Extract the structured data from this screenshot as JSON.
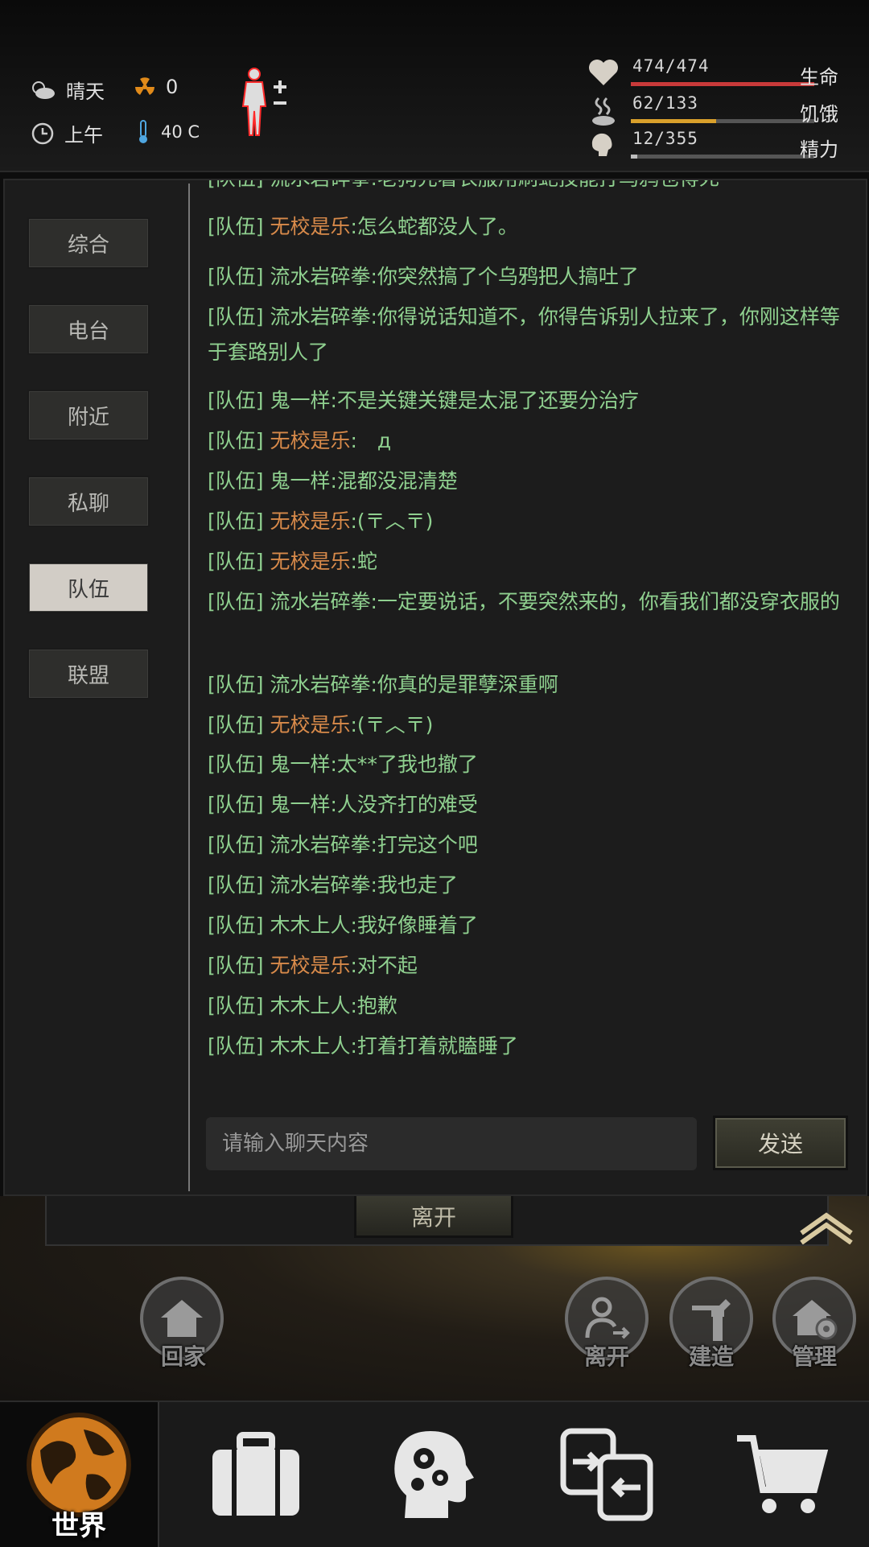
{
  "status": {
    "weather": "晴天",
    "radiation": "0",
    "time_of_day": "上午",
    "temperature": "40 C",
    "health": {
      "value": "474/474",
      "label": "生命",
      "fraction": 1.0,
      "color": "#c83a3a"
    },
    "hunger": {
      "value": "62/133",
      "label": "饥饿",
      "fraction": 0.466,
      "color": "#d9a02b"
    },
    "energy": {
      "value": "12/355",
      "label": "精力",
      "fraction": 0.034,
      "color": "#bdbdbd"
    }
  },
  "channels": [
    {
      "label": "综合",
      "active": false
    },
    {
      "label": "电台",
      "active": false
    },
    {
      "label": "附近",
      "active": false
    },
    {
      "label": "私聊",
      "active": false
    },
    {
      "label": "队伍",
      "active": true
    },
    {
      "label": "联盟",
      "active": false
    }
  ],
  "messages": [
    {
      "channel": "[队伍]",
      "sender": "流水岩碎拳",
      "text": ":老狗先看衣服用刷蛇技能打乌鸦也得死",
      "sender_color": "green"
    },
    {
      "channel": "[队伍]",
      "sender": "无校是乐",
      "text": ":怎么蛇都没人了。",
      "sender_color": "orange"
    },
    {
      "channel": "[队伍]",
      "sender": "流水岩碎拳",
      "text": ":你突然搞了个乌鸦把人搞吐了",
      "sender_color": "green"
    },
    {
      "channel": "[队伍]",
      "sender": "流水岩碎拳",
      "text": ":你得说话知道不，你得告诉别人拉来了，你刚这样等于套路别人了",
      "sender_color": "green"
    },
    {
      "channel": "[队伍]",
      "sender": "鬼一样",
      "text": ":不是关键关键是太混了还要分治疗",
      "sender_color": "green"
    },
    {
      "channel": "[队伍]",
      "sender": "无校是乐",
      "text": ":　д",
      "sender_color": "orange"
    },
    {
      "channel": "[队伍]",
      "sender": "鬼一样",
      "text": ":混都没混清楚",
      "sender_color": "green"
    },
    {
      "channel": "[队伍]",
      "sender": "无校是乐",
      "text": ":(〒︿〒)",
      "sender_color": "orange"
    },
    {
      "channel": "[队伍]",
      "sender": "无校是乐",
      "text": ":蛇",
      "sender_color": "orange"
    },
    {
      "channel": "[队伍]",
      "sender": "流水岩碎拳",
      "text": ":一定要说话，不要突然来的，你看我们都没穿衣服的",
      "sender_color": "green"
    },
    {
      "channel": "[队伍]",
      "sender": "流水岩碎拳",
      "text": ":你真的是罪孽深重啊",
      "sender_color": "green"
    },
    {
      "channel": "[队伍]",
      "sender": "无校是乐",
      "text": ":(〒︿〒)",
      "sender_color": "orange"
    },
    {
      "channel": "[队伍]",
      "sender": "鬼一样",
      "text": ":太**了我也撤了",
      "sender_color": "green"
    },
    {
      "channel": "[队伍]",
      "sender": "鬼一样",
      "text": ":人没齐打的难受",
      "sender_color": "green"
    },
    {
      "channel": "[队伍]",
      "sender": "流水岩碎拳",
      "text": ":打完这个吧",
      "sender_color": "green"
    },
    {
      "channel": "[队伍]",
      "sender": "流水岩碎拳",
      "text": ":我也走了",
      "sender_color": "green"
    },
    {
      "channel": "[队伍]",
      "sender": "木木上人",
      "text": ":我好像睡着了",
      "sender_color": "green"
    },
    {
      "channel": "[队伍]",
      "sender": "无校是乐",
      "text": ":对不起",
      "sender_color": "orange"
    },
    {
      "channel": "[队伍]",
      "sender": "木木上人",
      "text": ":抱歉",
      "sender_color": "green"
    },
    {
      "channel": "[队伍]",
      "sender": "木木上人",
      "text": ":打着打着就瞌睡了",
      "sender_color": "green"
    }
  ],
  "input": {
    "placeholder": "请输入聊天内容",
    "send_label": "发送"
  },
  "scene": {
    "leave_button": "离开",
    "actions": [
      {
        "label": "回家",
        "icon": "home-icon"
      },
      {
        "label": "离开",
        "icon": "person-exit-icon"
      },
      {
        "label": "建造",
        "icon": "hammer-icon"
      },
      {
        "label": "管理",
        "icon": "home-gear-icon"
      }
    ]
  },
  "nav": {
    "world_label": "世界",
    "tabs": [
      "globe-icon",
      "suitcase-icon",
      "head-gears-icon",
      "trade-swap-icon",
      "cart-icon"
    ]
  },
  "colors": {
    "message_green": "#8fd08f",
    "sender_orange": "#d88a4a",
    "active_tab": "#d2cdc6"
  }
}
